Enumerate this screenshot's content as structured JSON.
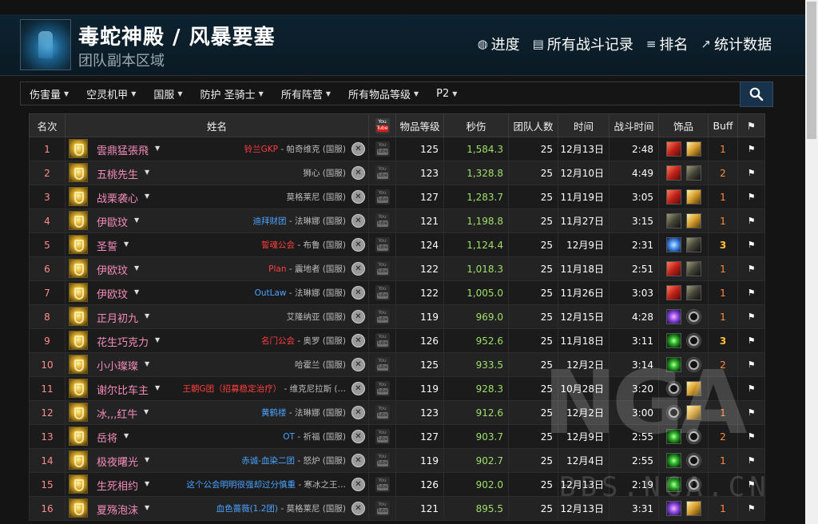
{
  "header": {
    "zone_title": "毒蛇神殿 / 风暴要塞",
    "zone_subtitle": "团队副本区域",
    "nav": [
      {
        "icon": "globe-icon",
        "glyph": "◍",
        "label": "进度"
      },
      {
        "icon": "list-icon",
        "glyph": "▤",
        "label": "所有战斗记录"
      },
      {
        "icon": "ranking-icon",
        "glyph": "≡",
        "label": "排名"
      },
      {
        "icon": "trend-icon",
        "glyph": "↗",
        "label": "统计数据"
      }
    ]
  },
  "filters": [
    {
      "label": "伤害量"
    },
    {
      "label": "空灵机甲"
    },
    {
      "label": "国服"
    },
    {
      "label": "防护 圣骑士"
    },
    {
      "label": "所有阵营"
    },
    {
      "label": "所有物品等级"
    },
    {
      "label": "P2"
    }
  ],
  "table": {
    "headers": {
      "rank": "名次",
      "name": "姓名",
      "youtube_top": "You",
      "youtube_bottom": "Tube",
      "ilvl": "物品等级",
      "dps": "秒伤",
      "size": "团队人数",
      "date": "时间",
      "duration": "战斗时间",
      "trinkets": "饰品",
      "buff": "Buff",
      "flag": "⚑"
    },
    "rows": [
      {
        "rank": "1",
        "name": "雲鼎猛張飛",
        "guild": "铃兰GKP",
        "guild_color": "red",
        "server": "- 帕奇维克 (国服)",
        "ilvl": "125",
        "dps": "1,584.3",
        "size": "25",
        "date": "12月13日",
        "duration": "2:48",
        "trinkets": [
          "red",
          "gold"
        ],
        "buff": "1"
      },
      {
        "rank": "2",
        "name": "五桃先生",
        "guild": "",
        "guild_color": "",
        "server": "狮心 (国服)",
        "ilvl": "123",
        "dps": "1,328.8",
        "size": "25",
        "date": "12月10日",
        "duration": "4:49",
        "trinkets": [
          "red",
          "dark"
        ],
        "buff": "2"
      },
      {
        "rank": "3",
        "name": "战栗袭心",
        "guild": "",
        "guild_color": "",
        "server": "莫格莱尼 (国服)",
        "ilvl": "127",
        "dps": "1,283.7",
        "size": "25",
        "date": "11月19日",
        "duration": "3:05",
        "trinkets": [
          "red",
          "gold"
        ],
        "buff": "1"
      },
      {
        "rank": "4",
        "name": "伊歐玟",
        "guild": "迪拜财团",
        "guild_color": "blue",
        "server": "- 法琳娜 (国服)",
        "ilvl": "121",
        "dps": "1,198.8",
        "size": "25",
        "date": "11月27日",
        "duration": "3:15",
        "trinkets": [
          "dark",
          "gold"
        ],
        "buff": "1"
      },
      {
        "rank": "5",
        "name": "圣誓",
        "guild": "誓魂公会",
        "guild_color": "red",
        "server": "- 布鲁 (国服)",
        "ilvl": "124",
        "dps": "1,124.4",
        "size": "25",
        "date": "12月9日",
        "duration": "2:31",
        "trinkets": [
          "blue",
          "dark"
        ],
        "buff": "3"
      },
      {
        "rank": "6",
        "name": "伊欧玟",
        "guild": "Plan",
        "guild_color": "red",
        "server": "- 震地者 (国服)",
        "ilvl": "122",
        "dps": "1,018.3",
        "size": "25",
        "date": "11月18日",
        "duration": "2:51",
        "trinkets": [
          "red",
          "dark"
        ],
        "buff": "1"
      },
      {
        "rank": "7",
        "name": "伊欧玟",
        "guild": "OutLaw",
        "guild_color": "blue",
        "server": "- 法琳娜 (国服)",
        "ilvl": "122",
        "dps": "1,005.0",
        "size": "25",
        "date": "11月26日",
        "duration": "3:03",
        "trinkets": [
          "red",
          "dark"
        ],
        "buff": "1"
      },
      {
        "rank": "8",
        "name": "正月初九",
        "guild": "",
        "guild_color": "",
        "server": "艾隆纳亚 (国服)",
        "ilvl": "119",
        "dps": "969.0",
        "size": "25",
        "date": "12月15日",
        "duration": "4:28",
        "trinkets": [
          "purp",
          "ring"
        ],
        "buff": "1"
      },
      {
        "rank": "9",
        "name": "花生巧克力",
        "guild": "名门公会",
        "guild_color": "red",
        "server": "- 奥罗 (国服)",
        "ilvl": "126",
        "dps": "952.6",
        "size": "25",
        "date": "11月18日",
        "duration": "3:11",
        "trinkets": [
          "green",
          "ring"
        ],
        "buff": "3"
      },
      {
        "rank": "10",
        "name": "小小璨璨",
        "guild": "",
        "guild_color": "",
        "server": "哈霍兰 (国服)",
        "ilvl": "125",
        "dps": "933.5",
        "size": "25",
        "date": "12月2日",
        "duration": "3:14",
        "trinkets": [
          "green",
          "ring"
        ],
        "buff": "2"
      },
      {
        "rank": "11",
        "name": "谢尔比车主",
        "guild": "王朝G团（招募稳定治疗）",
        "guild_color": "red",
        "server": "- 维克尼拉斯 (…",
        "ilvl": "119",
        "dps": "928.3",
        "size": "25",
        "date": "10月28日",
        "duration": "3:20",
        "trinkets": [
          "ring",
          "gold"
        ],
        "buff": ""
      },
      {
        "rank": "12",
        "name": "冰,,,红牛",
        "guild": "黄鹤楼",
        "guild_color": "blue",
        "server": "- 法琳娜 (国服)",
        "ilvl": "123",
        "dps": "912.6",
        "size": "25",
        "date": "12月2日",
        "duration": "3:00",
        "trinkets": [
          "ring",
          "gold"
        ],
        "buff": "1"
      },
      {
        "rank": "13",
        "name": "岳将",
        "guild": "OT",
        "guild_color": "blue",
        "server": "- 祈福 (国服)",
        "ilvl": "127",
        "dps": "903.7",
        "size": "25",
        "date": "12月9日",
        "duration": "2:55",
        "trinkets": [
          "green",
          "ring"
        ],
        "buff": "2"
      },
      {
        "rank": "14",
        "name": "极夜曙光",
        "guild": "赤诚-血染二团",
        "guild_color": "blue",
        "server": "- 怒炉 (国服)",
        "ilvl": "119",
        "dps": "902.7",
        "size": "25",
        "date": "12月4日",
        "duration": "2:55",
        "trinkets": [
          "green",
          "ring"
        ],
        "buff": "1"
      },
      {
        "rank": "15",
        "name": "生死相约",
        "guild": "这个公会明明很强却过分慎重",
        "guild_color": "blue",
        "server": "- 寒冰之王…",
        "ilvl": "126",
        "dps": "902.0",
        "size": "25",
        "date": "12月13日",
        "duration": "2:19",
        "trinkets": [
          "green",
          "ring"
        ],
        "buff": ""
      },
      {
        "rank": "16",
        "name": "夏殇泡沫",
        "guild": "血色蔷薇(1.2团)",
        "guild_color": "blue",
        "server": "- 莫格莱尼 (国服)",
        "ilvl": "121",
        "dps": "895.5",
        "size": "25",
        "date": "12月13日",
        "duration": "3:31",
        "trinkets": [
          "purp",
          "gold"
        ],
        "buff": "1"
      }
    ]
  },
  "watermark": {
    "logo": "NGA",
    "url": "BBS.NGA.CN"
  }
}
